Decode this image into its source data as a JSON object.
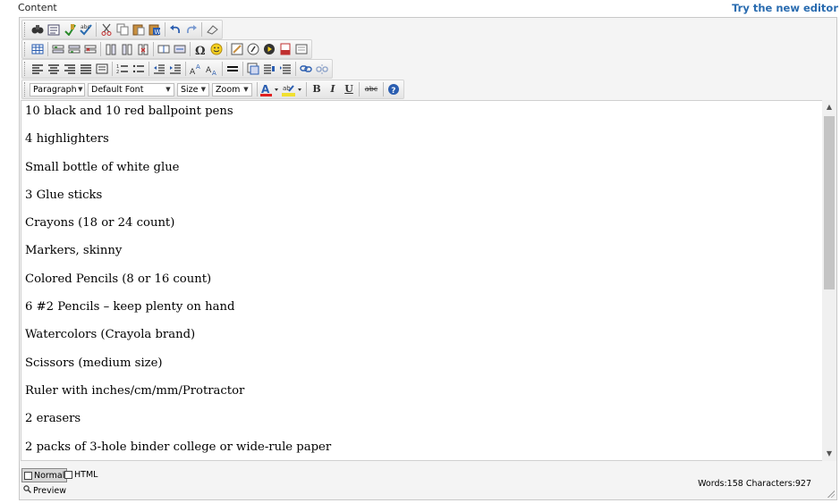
{
  "header": {
    "label": "Content",
    "try_link": "Try the new editor"
  },
  "toolbar": {
    "row1": [
      "binoculars-find-icon",
      "find-replace-icon",
      "spellcheck-icon",
      "spellcheck-check-icon",
      "cut-icon",
      "copy-icon",
      "paste-icon",
      "paste-word-icon",
      "undo-icon",
      "redo-icon",
      "eraser-icon"
    ],
    "row2": [
      "insert-table-icon",
      "insert-row-before-icon",
      "insert-row-after-icon",
      "delete-row-icon",
      "insert-col-before-icon",
      "insert-col-after-icon",
      "delete-col-icon",
      "split-cell-icon",
      "merge-cells-icon",
      "special-char-icon",
      "emoticon-icon",
      "insert-image-icon",
      "insert-flash-icon",
      "insert-media-icon",
      "insert-pdf-icon",
      "insert-form-icon"
    ],
    "row3": [
      "align-left-icon",
      "align-center-icon",
      "align-right-icon",
      "align-justify-icon",
      "align-full-icon",
      "ordered-list-icon",
      "unordered-list-icon",
      "outdent-icon",
      "indent-icon",
      "superscript-icon",
      "subscript-icon",
      "horizontal-rule-icon",
      "insert-template-icon",
      "insert-snippet-icon",
      "bookmark-icon",
      "link-icon",
      "unlink-icon"
    ],
    "paragraph": "Paragraph",
    "font": "Default Font",
    "size": "Size",
    "zoom": "Zoom",
    "colors": {
      "font_color": "#e02020",
      "highlight_color": "#f0e030",
      "help": "#2a5db0"
    },
    "bold": "B",
    "italic": "I",
    "underline": "U",
    "strike": "abc"
  },
  "document": {
    "lines": [
      "10 black and 10 red ballpoint pens",
      "4 highlighters",
      "Small bottle of white glue",
      "3 Glue sticks",
      "Crayons (18 or 24 count)",
      "Markers, skinny",
      "Colored Pencils (8 or 16 count)",
      "6 #2 Pencils – keep plenty on hand",
      "Watercolors (Crayola brand)",
      "Scissors (medium size)",
      "Ruler with inches/cm/mm/Protractor",
      "2 erasers",
      "2 packs of 3-hole binder college or wide-rule paper"
    ]
  },
  "footer": {
    "normal": "Normal",
    "html": "HTML",
    "preview": "Preview",
    "stats": "Words:158 Characters:927"
  }
}
